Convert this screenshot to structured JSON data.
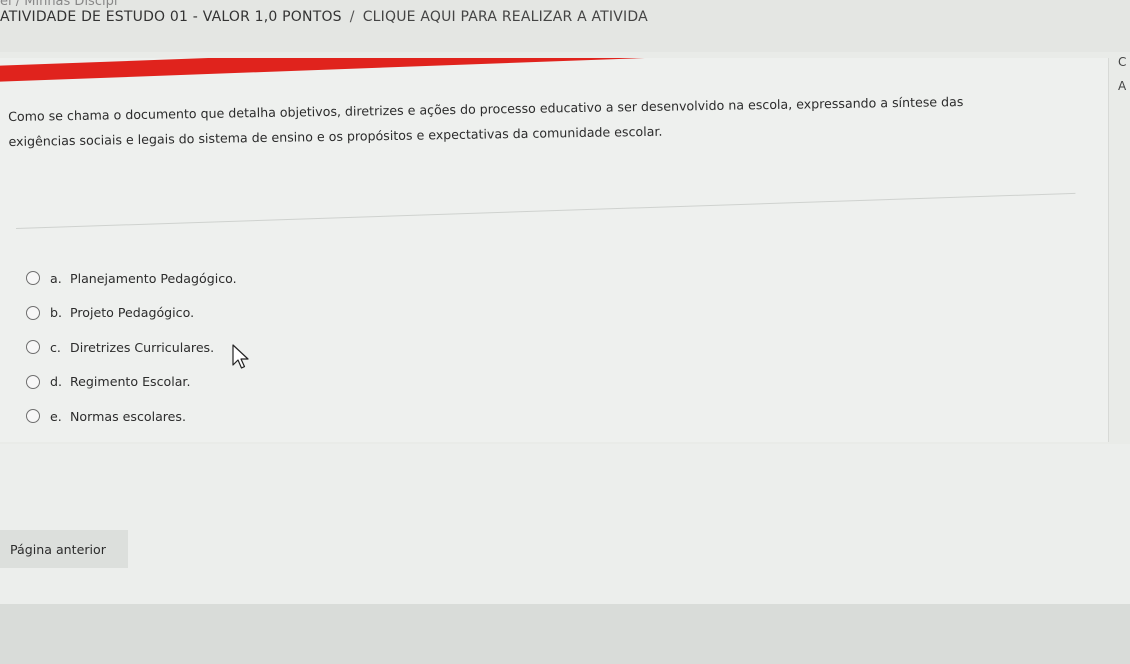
{
  "breadcrumb": {
    "parent_fragment": "el / Minhas Discipl",
    "activity_title": "ATIVIDADE DE ESTUDO 01 - VALOR 1,0 PONTOS",
    "separator": "/",
    "action_link": "CLIQUE AQUI PARA REALIZAR A ATIVIDA"
  },
  "question": {
    "text_line1": "Como se chama o documento que detalha objetivos, diretrizes e ações do processo educativo a ser desenvolvido na escola, expressando a síntese das",
    "text_line2": "exigências sociais e legais do sistema de ensino e os propósitos e expectativas da comunidade escolar."
  },
  "options": [
    {
      "letter": "a.",
      "label": "Planejamento Pedagógico."
    },
    {
      "letter": "b.",
      "label": "Projeto Pedagógico."
    },
    {
      "letter": "c.",
      "label": "Diretrizes Curriculares."
    },
    {
      "letter": "d.",
      "label": "Regimento Escolar."
    },
    {
      "letter": "e.",
      "label": "Normas escolares."
    }
  ],
  "navigation": {
    "prev_label": "Página anterior"
  },
  "side_fragments": {
    "letter1": "C",
    "letter2": "A"
  },
  "colors": {
    "accent_bar": "#e0231d"
  },
  "icons": {
    "radio": "radio-unchecked-icon",
    "cursor": "mouse-pointer-icon"
  }
}
